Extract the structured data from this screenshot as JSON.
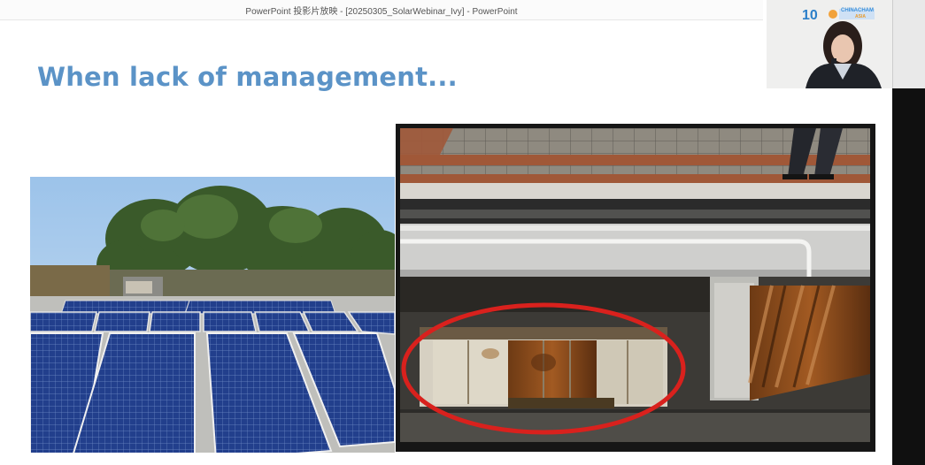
{
  "window": {
    "title": "PowerPoint 投影片放映 - [20250305_SolarWebinar_Ivy] - PowerPoint"
  },
  "slide": {
    "title": "When lack of management...",
    "title_color": "#5b93c7"
  },
  "webcam": {
    "logo_text": "CHINACHAM",
    "logo_subtext": "ASIA",
    "icons": [
      "10th-anniversary-logo",
      "organization-logo"
    ]
  },
  "images": {
    "left": "solar-panels-on-rooftop",
    "right": "corroded-rusted-rooftop-equipment-highlighted"
  },
  "colors": {
    "highlight_ring": "#d9211d",
    "panel_blue": "#1f3e8a",
    "rust": "#8a4a1a"
  }
}
